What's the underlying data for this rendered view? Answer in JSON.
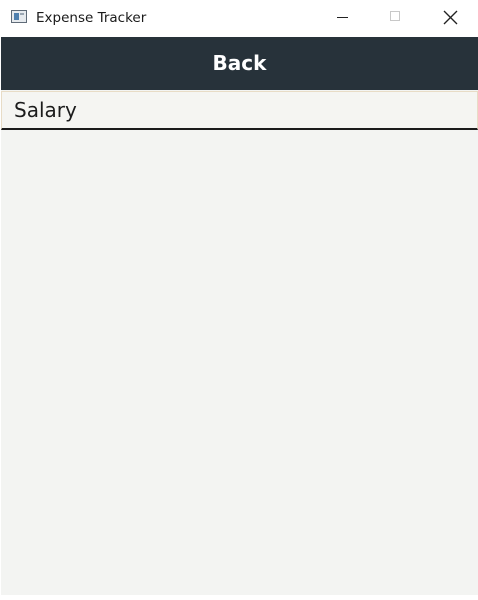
{
  "window": {
    "title": "Expense Tracker",
    "icon": "app-window-icon",
    "controls": [
      "minimize-icon",
      "maximize-icon",
      "close-icon"
    ]
  },
  "toolbar": {
    "back_label": "Back"
  },
  "list": {
    "items": [
      {
        "label": "Salary"
      }
    ]
  },
  "colors": {
    "header_bg": "#27323a",
    "client_bg": "#f3f4f2",
    "item_underline": "#1b1b1b"
  }
}
